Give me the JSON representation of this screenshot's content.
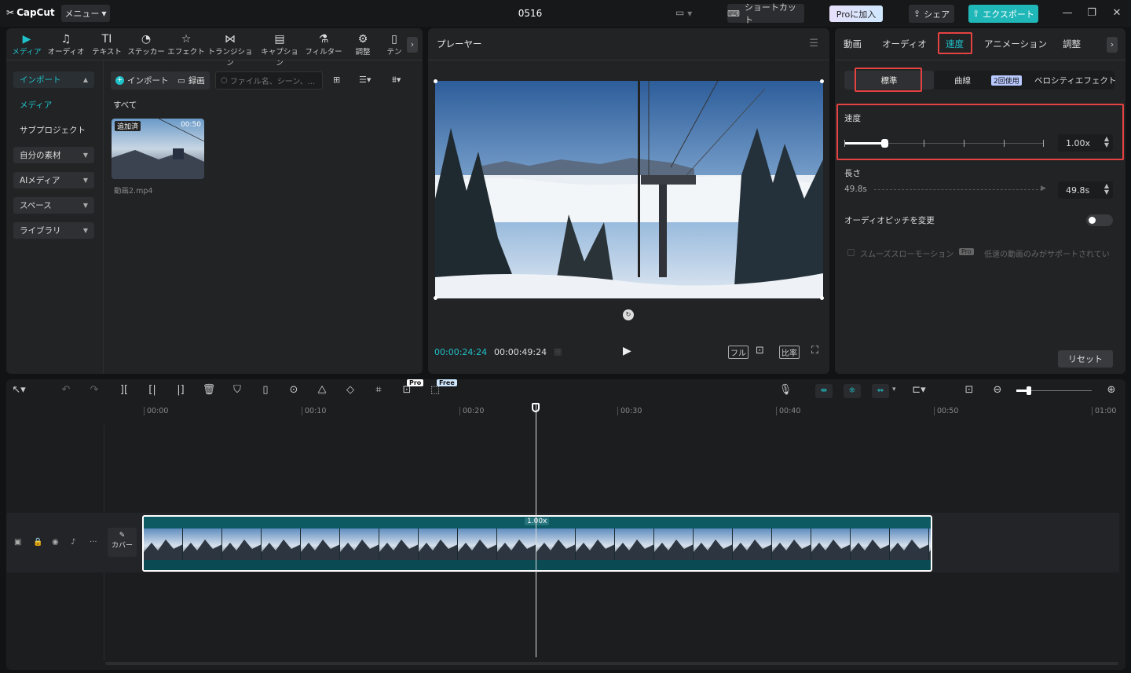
{
  "app": {
    "logo": "CapCut",
    "menu": "メニュー",
    "title": "0516"
  },
  "header": {
    "shortcut": "ショートカット",
    "pro": "Proに加入",
    "share": "シェア",
    "export": "エクスポート"
  },
  "toolbar": [
    {
      "label": "メディア",
      "icon": "media-icon"
    },
    {
      "label": "オーディオ",
      "icon": "audio-icon"
    },
    {
      "label": "テキスト",
      "icon": "text-icon"
    },
    {
      "label": "ステッカー",
      "icon": "sticker-icon"
    },
    {
      "label": "エフェクト",
      "icon": "effect-icon"
    },
    {
      "label": "トランジション",
      "icon": "transition-icon"
    },
    {
      "label": "キャプション",
      "icon": "caption-icon"
    },
    {
      "label": "フィルター",
      "icon": "filter-icon"
    },
    {
      "label": "調整",
      "icon": "adjust-icon"
    },
    {
      "label": "テン",
      "icon": "template-icon"
    }
  ],
  "sidebar": {
    "import": "インポート",
    "media": "メディア",
    "subproject": "サブプロジェクト",
    "mine": "自分の素材",
    "ai": "AIメディア",
    "space": "スペース",
    "library": "ライブラリ"
  },
  "media": {
    "import_btn": "インポート",
    "record_btn": "録画",
    "search_placeholder": "ファイル名、シーン、...",
    "filter_all": "すべて",
    "item": {
      "badge": "追加済",
      "duration": "00:50",
      "name": "動画2.mp4"
    }
  },
  "player": {
    "title": "プレーヤー",
    "current": "00:00:24:24",
    "total": "00:00:49:24",
    "full": "フル",
    "ratio": "比率"
  },
  "right": {
    "tabs": [
      "動画",
      "オーディオ",
      "速度",
      "アニメーション",
      "調整"
    ],
    "subtabs": {
      "standard": "標準",
      "curve": "曲線",
      "badge": "2回使用",
      "velocity": "ベロシティエフェクト"
    },
    "speed_label": "速度",
    "speed_value": "1.00x",
    "speed_level": 0.2,
    "length_label": "長さ",
    "length_original": "49.8s",
    "length_value": "49.8s",
    "pitch_label": "オーディオピッチを変更",
    "smooth_label": "スムーズスローモーション",
    "smooth_pro": "Pro",
    "smooth_note": "低速の動画のみがサポートされてい",
    "reset": "リセット"
  },
  "timeline": {
    "pro_badge": "Pro",
    "free_badge": "Free",
    "ruler": [
      "00:00",
      "00:10",
      "00:20",
      "00:30",
      "00:40",
      "00:50",
      "01:00"
    ],
    "clip_speed": "1.00x",
    "cover": "カバー"
  },
  "colors": {
    "accent": "#1fc2c9",
    "highlight": "#e54242",
    "clip": "#0f5961"
  }
}
